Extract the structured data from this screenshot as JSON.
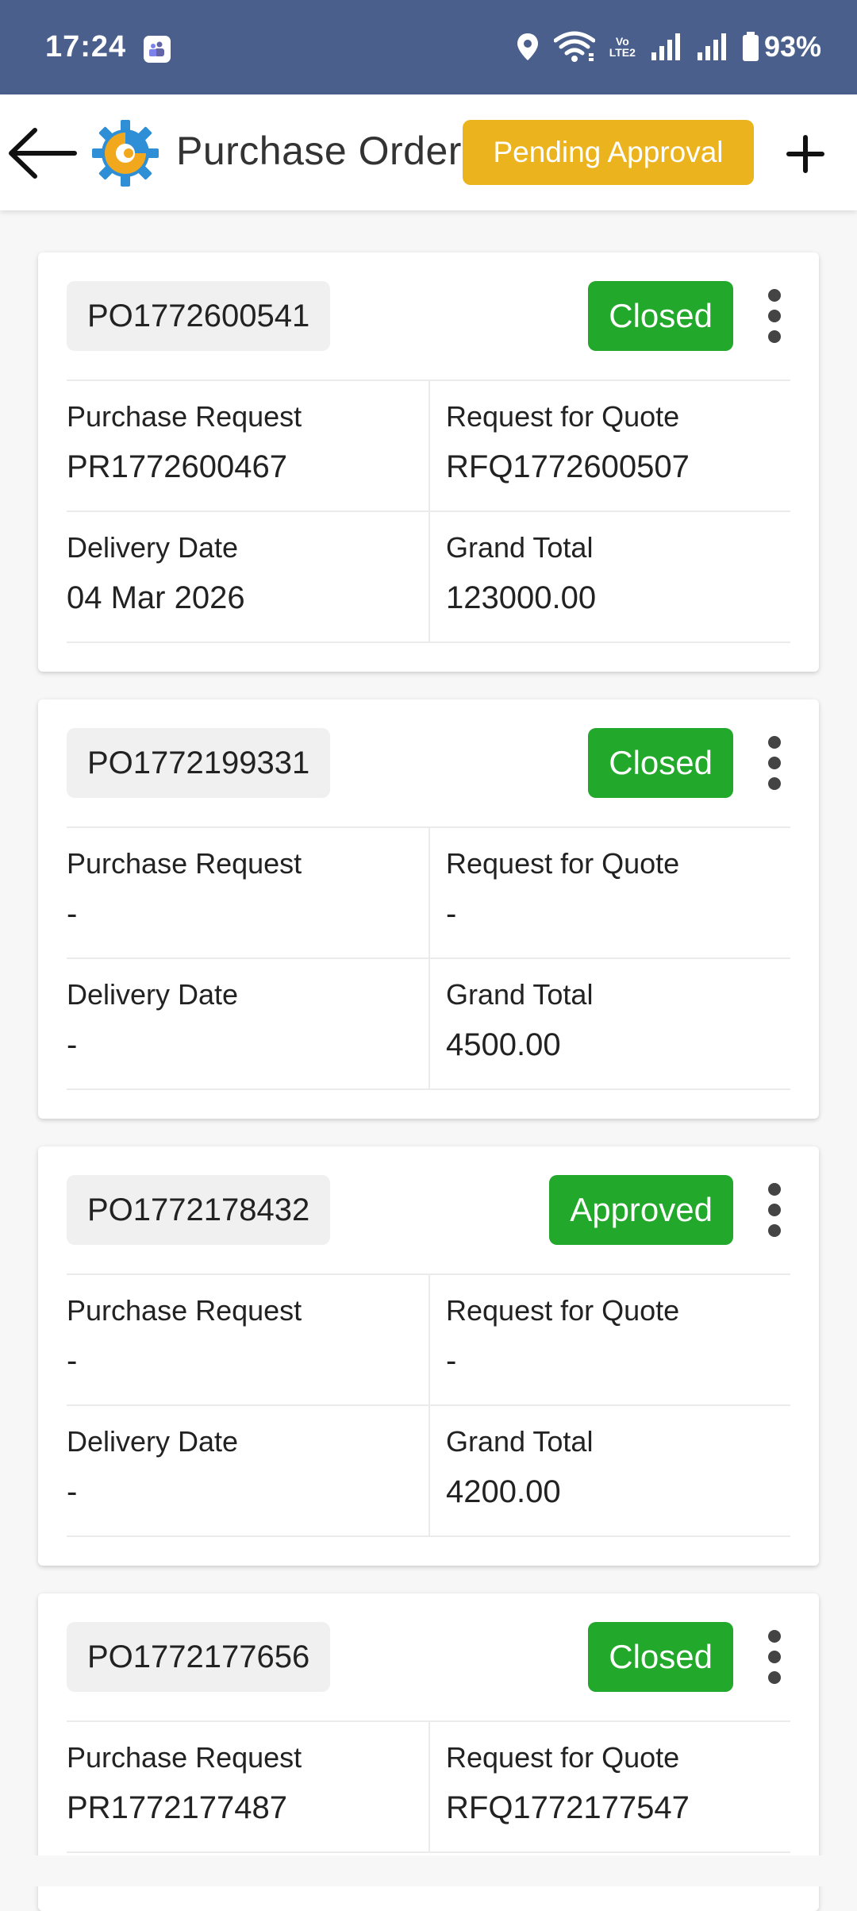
{
  "status_bar": {
    "time": "17:24",
    "battery": "93%",
    "volte_top": "Vo",
    "volte_bottom": "LTE2",
    "icons": [
      "teams-notification-icon",
      "location-icon",
      "wifi-icon",
      "volte-icon",
      "signal-icon",
      "signal-icon",
      "battery-icon"
    ]
  },
  "app_bar": {
    "title": "Purchase Orders",
    "pending_label": "Pending Approval",
    "icons": [
      "back-arrow-icon",
      "app-logo",
      "plus-icon"
    ],
    "colors": {
      "accent": "#ebb41f",
      "logo_blue": "#2f8fd6",
      "logo_orange": "#f2a81d"
    }
  },
  "orders": [
    {
      "po": "PO1772600541",
      "status": "Closed",
      "purchase_request_label": "Purchase Request",
      "purchase_request": "PR1772600467",
      "rfq_label": "Request for Quote",
      "rfq": "RFQ1772600507",
      "delivery_label": "Delivery Date",
      "delivery": "04 Mar 2026",
      "total_label": "Grand Total",
      "total": "123000.00"
    },
    {
      "po": "PO1772199331",
      "status": "Closed",
      "purchase_request_label": "Purchase Request",
      "purchase_request": "-",
      "rfq_label": "Request for Quote",
      "rfq": "-",
      "delivery_label": "Delivery Date",
      "delivery": "-",
      "total_label": "Grand Total",
      "total": "4500.00"
    },
    {
      "po": "PO1772178432",
      "status": "Approved",
      "purchase_request_label": "Purchase Request",
      "purchase_request": "-",
      "rfq_label": "Request for Quote",
      "rfq": "-",
      "delivery_label": "Delivery Date",
      "delivery": "-",
      "total_label": "Grand Total",
      "total": "4200.00"
    },
    {
      "po": "PO1772177656",
      "status": "Closed",
      "purchase_request_label": "Purchase Request",
      "purchase_request": "PR1772177487",
      "rfq_label": "Request for Quote",
      "rfq": "RFQ1772177547"
    }
  ],
  "colors": {
    "status_green": "#22a82a",
    "status_bar": "#4a5f8c"
  }
}
